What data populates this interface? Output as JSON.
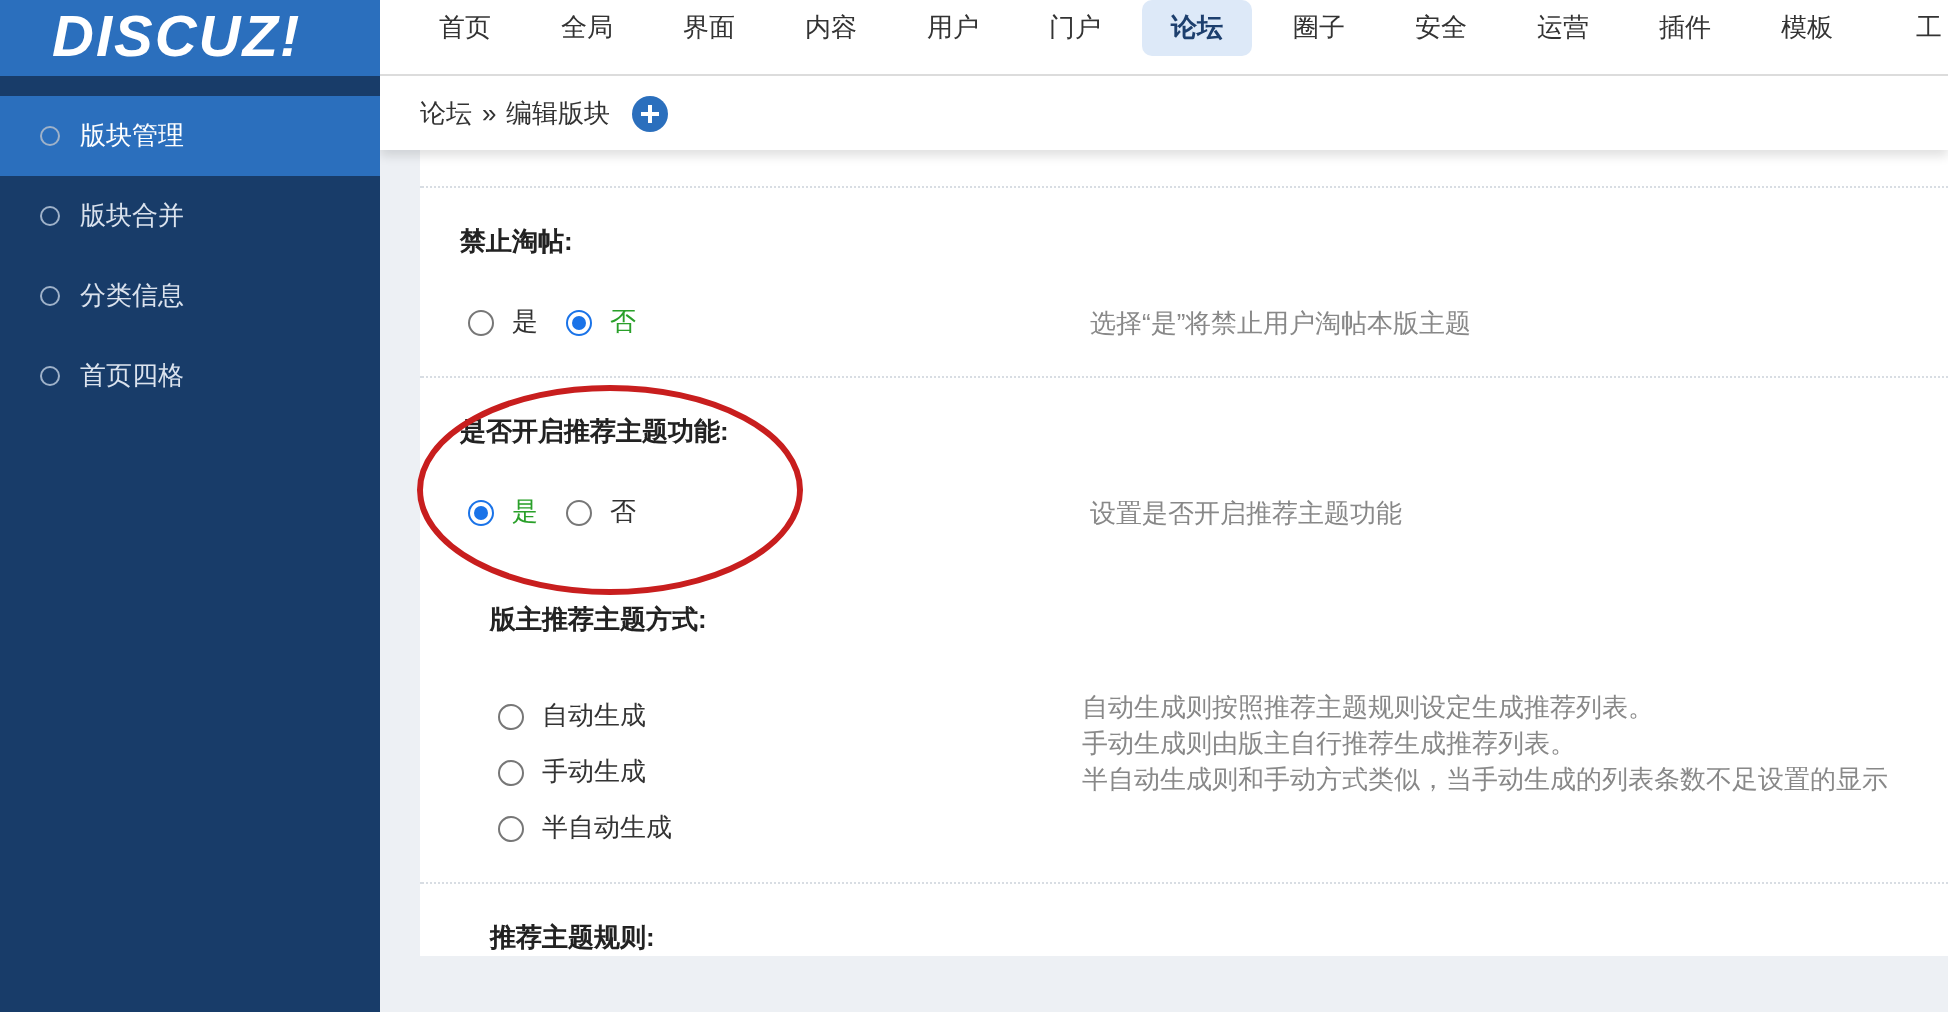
{
  "logo": "DISCUZ!",
  "nav": [
    {
      "label": "首页",
      "selected": false
    },
    {
      "label": "全局",
      "selected": false
    },
    {
      "label": "界面",
      "selected": false
    },
    {
      "label": "内容",
      "selected": false
    },
    {
      "label": "用户",
      "selected": false
    },
    {
      "label": "门户",
      "selected": false
    },
    {
      "label": "论坛",
      "selected": true
    },
    {
      "label": "圈子",
      "selected": false
    },
    {
      "label": "安全",
      "selected": false
    },
    {
      "label": "运营",
      "selected": false
    },
    {
      "label": "插件",
      "selected": false
    },
    {
      "label": "模板",
      "selected": false
    },
    {
      "label": "工",
      "selected": false
    }
  ],
  "sidebar": {
    "items": [
      {
        "label": "版块管理",
        "selected": true
      },
      {
        "label": "版块合并",
        "selected": false
      },
      {
        "label": "分类信息",
        "selected": false
      },
      {
        "label": "首页四格",
        "selected": false
      }
    ]
  },
  "breadcrumb": {
    "items": [
      "论坛",
      "编辑版块"
    ],
    "separator": "»"
  },
  "settings": [
    {
      "kind": "inline",
      "title": "禁止淘帖:",
      "options": [
        {
          "label": "是",
          "selected": false
        },
        {
          "label": "否",
          "selected": true
        }
      ],
      "description": [
        "选择“是”将禁止用户淘帖本版主题"
      ]
    },
    {
      "kind": "inline",
      "title": "是否开启推荐主题功能:",
      "highlighted": true,
      "options": [
        {
          "label": "是",
          "selected": true
        },
        {
          "label": "否",
          "selected": false
        }
      ],
      "description": [
        "设置是否开启推荐主题功能"
      ],
      "children": [
        {
          "kind": "stacked",
          "title": "版主推荐主题方式:",
          "options": [
            {
              "label": "自动生成",
              "selected": false
            },
            {
              "label": "手动生成",
              "selected": false
            },
            {
              "label": "半自动生成",
              "selected": false
            }
          ],
          "description": [
            "自动生成则按照推荐主题规则设定生成推荐列表。",
            "手动生成则由版主自行推荐生成推荐列表。",
            "半自动生成则和手动方式类似，当手动生成的列表条数不足设置的显示"
          ]
        },
        {
          "kind": "heading",
          "title": "推荐主题规则:"
        }
      ]
    }
  ]
}
